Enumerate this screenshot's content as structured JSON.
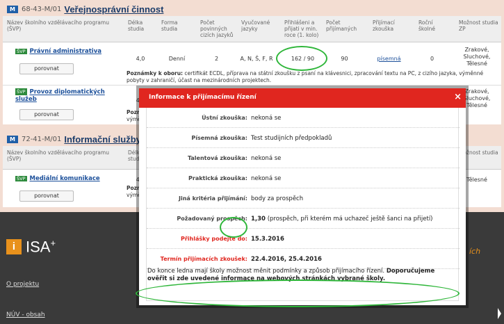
{
  "group1": {
    "badge": "M",
    "code": "68-43-M/01",
    "title": "Veřejnosprávní činnost"
  },
  "group2": {
    "badge": "M",
    "code": "72-41-M/01",
    "title": "Informační služby"
  },
  "columns": {
    "name": "Název školního vzdělávacího programu (ŠVP)",
    "length": "Délka studia",
    "form": "Forma studia",
    "foreign_lang_count": "Počet povinných cizích jazyků",
    "languages": "Vyučované jazyky",
    "applied_last": "Přihlášeni a přijati v min. roce (1. kolo)",
    "accepted_count": "Počet přijímaných",
    "entrance_exam": "Přijímací zkouška",
    "annual_fee": "Roční školné",
    "zp_study": "Možnost studia ZP"
  },
  "svp_badge": "ŠVP",
  "compare_label": "porovnat",
  "programs": [
    {
      "name": "Právní administrativa",
      "length": "4,0",
      "form": "Denní",
      "foreign_lang_count": "2",
      "languages": "A, N, Š, F, R",
      "applied_last": "162 / 90",
      "accepted_count": "90",
      "entrance_exam": "písemná",
      "annual_fee": "0",
      "zp_study": "Zrakové, Sluchové, Tělesné",
      "note_label": "Poznámky k oboru:",
      "note_text": "certifikát ECDL, příprava na státní zkoušku z psaní na klávesnici, zpracování textu na PC, z cizího jazyka, výměnné pobyty v zahraničí, účast na mezinárodních projektech."
    },
    {
      "name": "Provoz diplomatických služeb",
      "length": "4,0",
      "zp_study": "Zrakové, Sluchové, Tělesné",
      "note_label": "Pozn",
      "note_text": "výmě"
    },
    {
      "name": "Mediální komunikace",
      "length": "4,0",
      "zp_study": "Tělesné",
      "note_label": "Pozn",
      "note_text": "výmě"
    }
  ],
  "group2_columns": {
    "name": "Název školního vzdělávacího programu (ŠVP)",
    "length": "Délka studia",
    "zp_study": "Možnost studia ZP"
  },
  "modal": {
    "title": "Informace k přijímacímu řízení",
    "close": "×",
    "rows": [
      {
        "label": "Ústní zkouška:",
        "value": "nekoná se"
      },
      {
        "label": "Písemná zkouška:",
        "value": "Test studijních předpokladů"
      },
      {
        "label": "Talentová zkouška:",
        "value": "nekoná se"
      },
      {
        "label": "Praktická zkouška:",
        "value": "nekoná se"
      },
      {
        "label": "Jiná kritéria přijímání:",
        "value": "body za prospěch"
      },
      {
        "label": "Požadovaný prospěch:",
        "value_bold": "1,30",
        "value": "(prospěch, při kterém má uchazeč ještě šanci na přijetí)"
      },
      {
        "label": "Přihlášky podejte do:",
        "value": "15.3.2016"
      },
      {
        "label": "Termín přijímacích zkoušek:",
        "value": "22.4.2016, 25.4.2016"
      }
    ],
    "note_plain": "Do konce ledna mají školy možnost měnit podmínky a způsob přijímacího řízení.",
    "note_bold": "Doporučujeme ověřit si zde uvedené informace na webových stránkách vybrané školy."
  },
  "footer": {
    "logo_letter": "i",
    "logo_text": "ISA",
    "logo_sup": "+",
    "about_link": "O projektu",
    "partial_link": "NÚV - obsah",
    "right_fragment": "ích"
  },
  "colors": {
    "accent_red": "#e0261f",
    "highlight_green": "#2fb63a",
    "brand_orange": "#e8911c",
    "link_blue": "#1b4f9a"
  }
}
